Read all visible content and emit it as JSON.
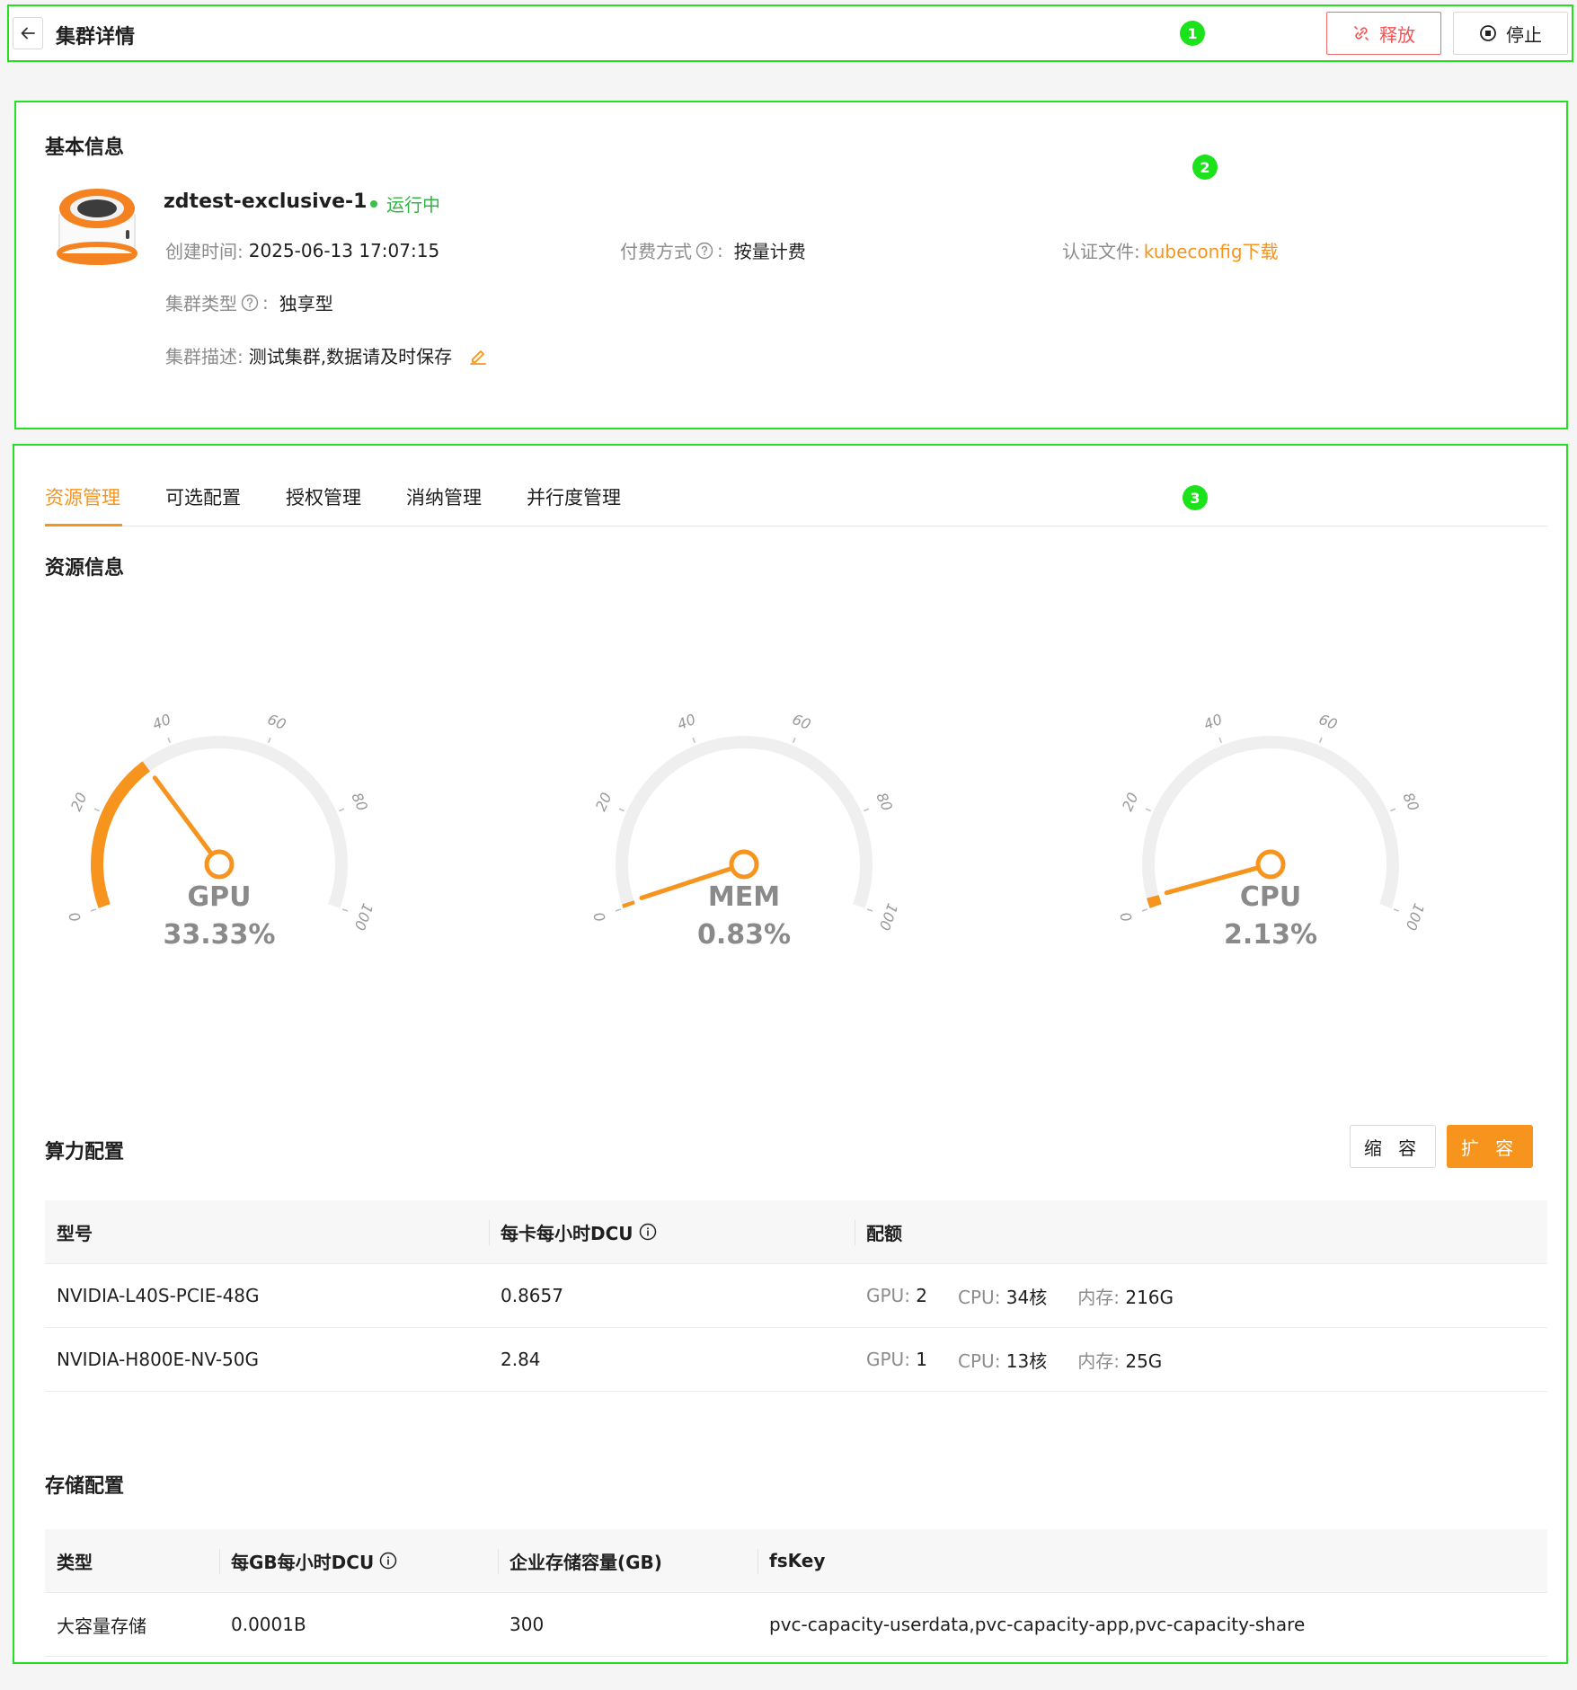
{
  "header": {
    "title": "集群详情",
    "badge": "1",
    "release_label": "释放",
    "stop_label": "停止"
  },
  "basic": {
    "badge": "2",
    "section_title": "基本信息",
    "cluster_name": "zdtest-exclusive-1",
    "status": "运行中",
    "created_label": "创建时间:",
    "created_value": "2025-06-13 17:07:15",
    "pay_label": "付费方式",
    "pay_value": "按量计费",
    "auth_label": "认证文件:",
    "auth_link": "kubeconfig下载",
    "type_label": "集群类型",
    "type_value": "独享型",
    "desc_label": "集群描述:",
    "desc_value": "测试集群,数据请及时保存",
    "colon": ":"
  },
  "main": {
    "badge": "3",
    "tabs": [
      {
        "label": "资源管理"
      },
      {
        "label": "可选配置"
      },
      {
        "label": "授权管理"
      },
      {
        "label": "消纳管理"
      },
      {
        "label": "并行度管理"
      }
    ],
    "resource_title": "资源信息",
    "compute_title": "算力配置",
    "shrink_label": "缩 容",
    "expand_label": "扩 容",
    "storage_title": "存储配置"
  },
  "gauges": [
    {
      "name": "GPU",
      "value": 33.33,
      "display": "33.33%"
    },
    {
      "name": "MEM",
      "value": 0.83,
      "display": "0.83%"
    },
    {
      "name": "CPU",
      "value": 2.13,
      "display": "2.13%"
    }
  ],
  "gauge_ticks": [
    "0",
    "20",
    "40",
    "60",
    "80",
    "100"
  ],
  "compute_table": {
    "headers": [
      "型号",
      "每卡每小时DCU",
      "配额"
    ],
    "quota_keys": [
      "GPU:",
      "CPU:",
      "内存:"
    ],
    "rows": [
      {
        "model": "NVIDIA-L40S-PCIE-48G",
        "dcu": "0.8657",
        "gpu": "2",
        "cpu": "34核",
        "mem": "216G"
      },
      {
        "model": "NVIDIA-H800E-NV-50G",
        "dcu": "2.84",
        "gpu": "1",
        "cpu": "13核",
        "mem": "25G"
      }
    ]
  },
  "storage_table": {
    "headers": [
      "类型",
      "每GB每小时DCU",
      "企业存储容量(GB)",
      "fsKey"
    ],
    "rows": [
      {
        "type": "大容量存储",
        "dcu": "0.0001B",
        "capacity": "300",
        "fskey": "pvc-capacity-userdata,pvc-capacity-app,pvc-capacity-share"
      }
    ]
  },
  "colors": {
    "accent": "#f7941d",
    "danger": "#f25252",
    "success": "#2fb344",
    "annotation": "#22e022"
  }
}
